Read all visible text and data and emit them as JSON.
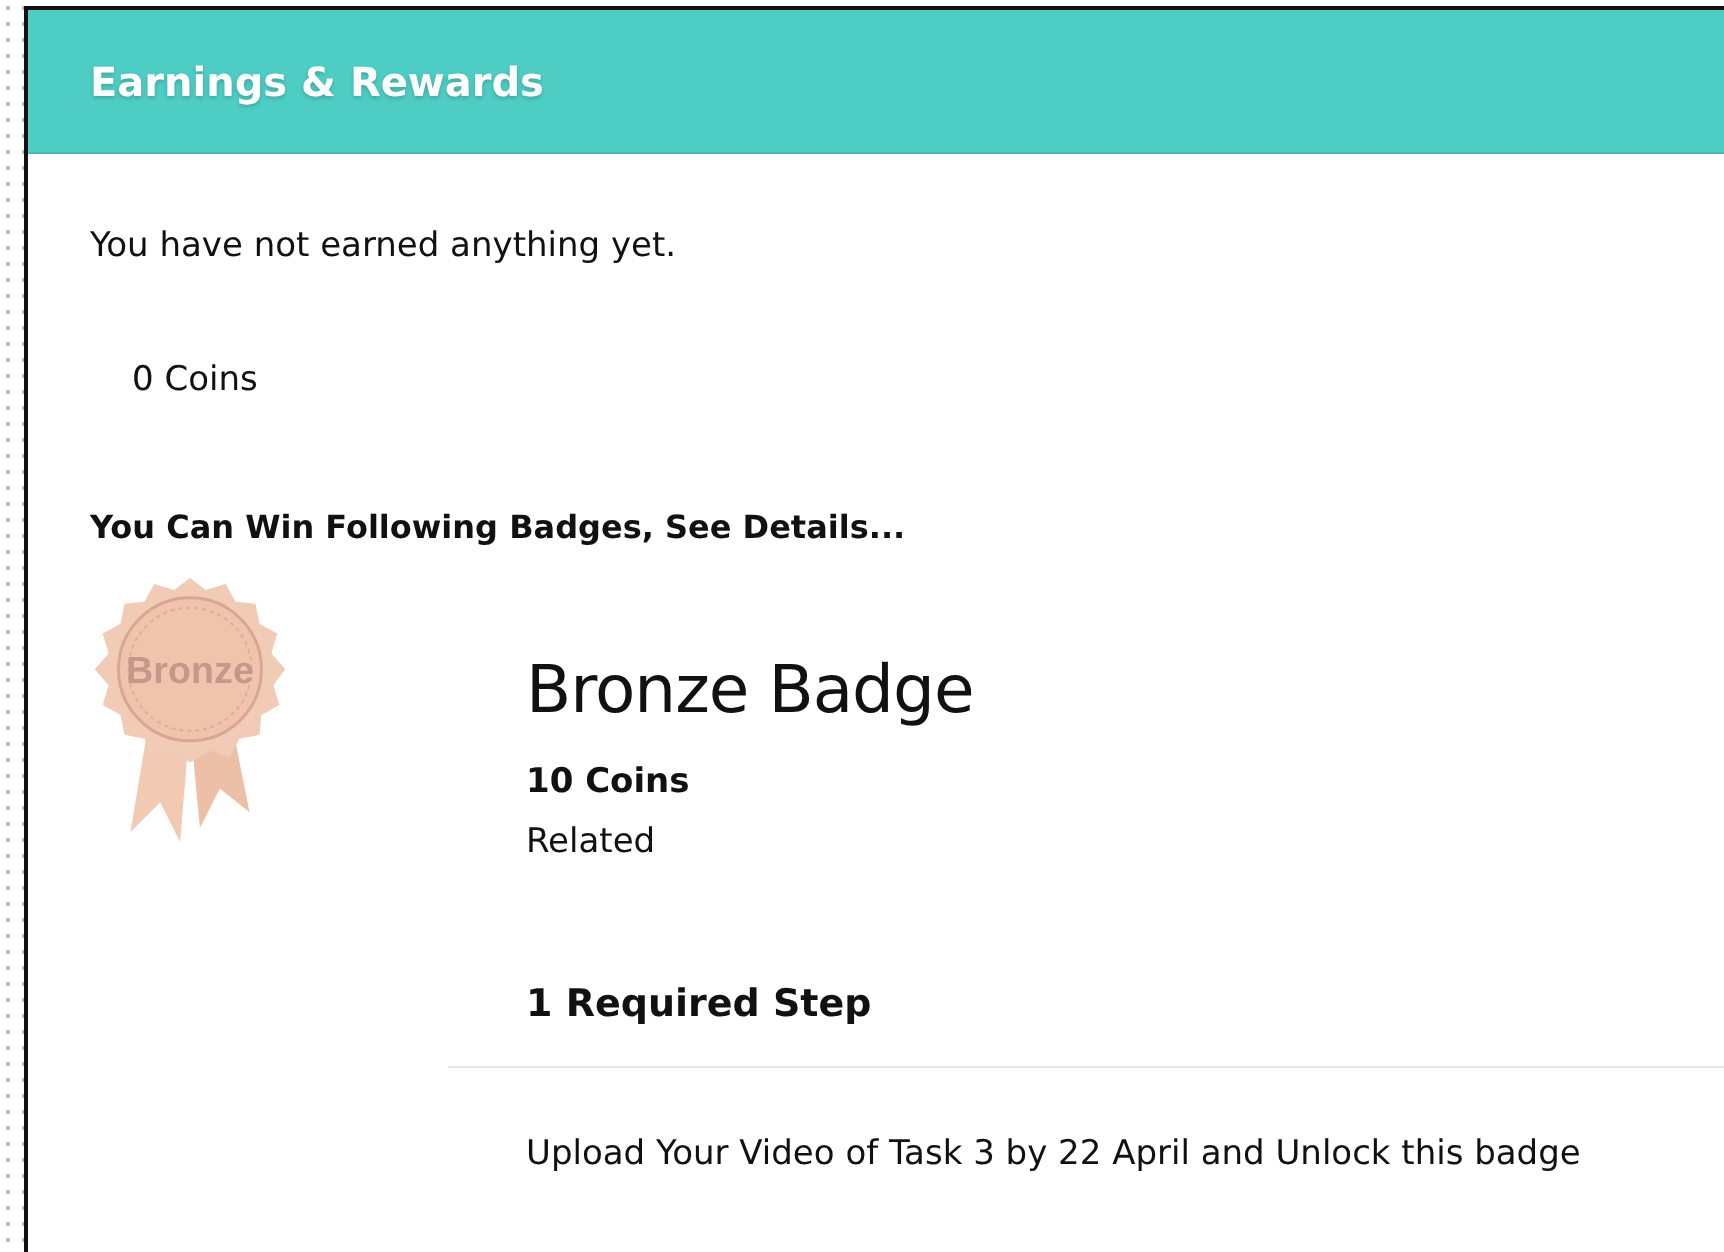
{
  "header": {
    "title": "Earnings & Rewards"
  },
  "message": "You have not earned anything yet.",
  "coins": "0 Coins",
  "badges_heading": "You Can Win Following Badges, See Details...",
  "badges": [
    {
      "emblem_label": "Bronze",
      "name": "Bronze Badge",
      "coins": "10 Coins",
      "related": "Related",
      "steps_heading": "1 Required Step",
      "steps": [
        "Upload Your Video of Task 3 by 22 April and Unlock this badge"
      ]
    }
  ]
}
